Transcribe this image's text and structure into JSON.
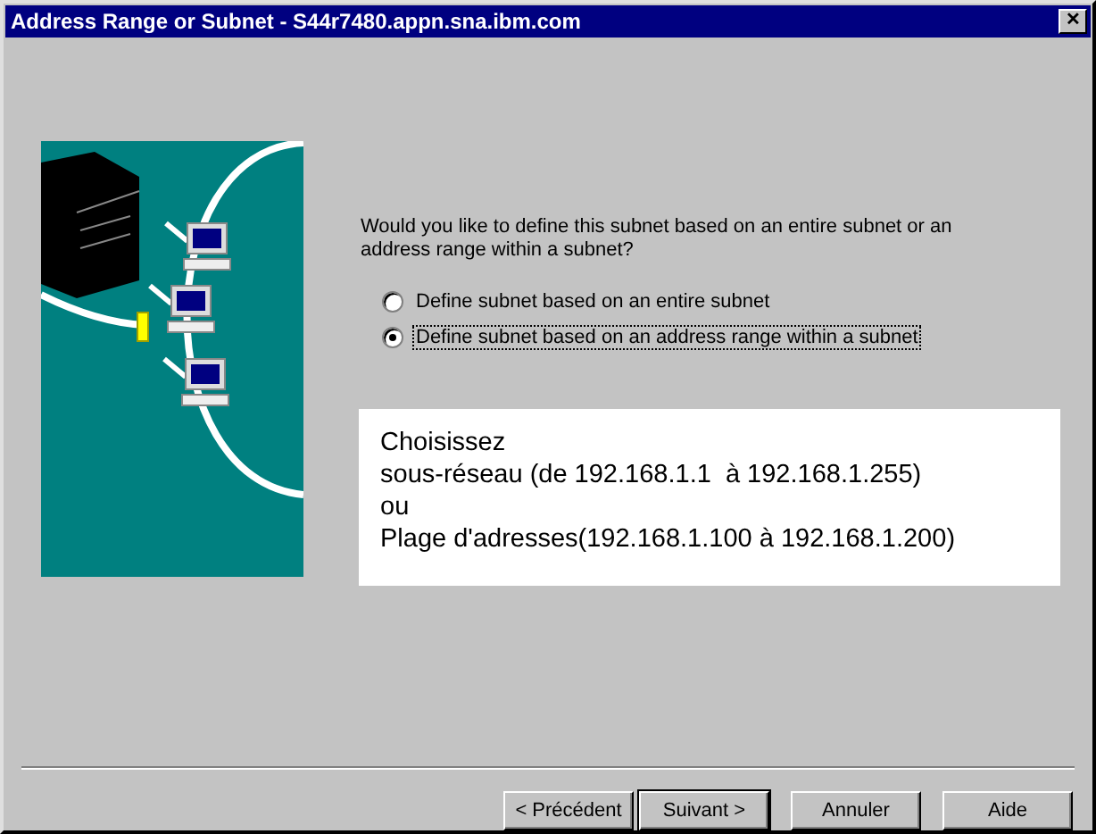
{
  "window": {
    "title": "Address Range or Subnet - S44r7480.appn.sna.ibm.com",
    "close": "✕"
  },
  "question": "Would you like to define this subnet based on an entire subnet or an address range within a subnet?",
  "options": [
    {
      "label": "Define subnet based on an entire subnet",
      "selected": false
    },
    {
      "label": "Define subnet based on an address range within a subnet",
      "selected": true
    }
  ],
  "note": [
    "Choisissez",
    "sous-réseau (de 192.168.1.1  à 192.168.1.255)",
    "ou",
    "Plage d'adresses(192.168.1.100 à 192.168.1.200)"
  ],
  "buttons": [
    {
      "label": "< Précédent",
      "default": false
    },
    {
      "label": "Suivant >",
      "default": true
    },
    {
      "label": "Annuler",
      "default": false
    },
    {
      "label": "Aide",
      "default": false
    }
  ]
}
